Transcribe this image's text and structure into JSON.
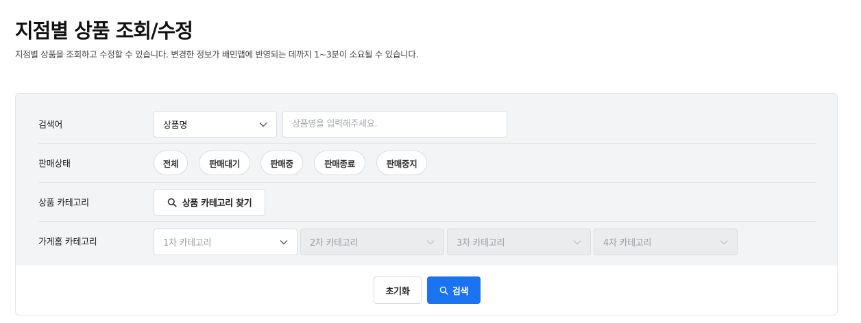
{
  "header": {
    "title": "지점별 상품 조회/수정",
    "description": "지점별 상품을 조회하고 수정할 수 있습니다. 변경한 정보가 배민앱에 반영되는 데까지 1~3분이 소요될 수 있습니다."
  },
  "filters": {
    "keyword": {
      "label": "검색어",
      "type_select_value": "상품명",
      "input_placeholder": "상품명을 입력해주세요.",
      "input_value": ""
    },
    "sale_status": {
      "label": "판매상태",
      "chips": [
        "전체",
        "판매대기",
        "판매중",
        "판매종료",
        "판매중지"
      ]
    },
    "product_category": {
      "label": "상품 카테고리",
      "button_label": "상품 카테고리 찾기"
    },
    "store_category": {
      "label": "가게홈 카테고리",
      "selects": [
        {
          "placeholder": "1차 카테고리",
          "disabled": false
        },
        {
          "placeholder": "2차 카테고리",
          "disabled": true
        },
        {
          "placeholder": "3차 카테고리",
          "disabled": true
        },
        {
          "placeholder": "4차 카테고리",
          "disabled": true
        }
      ]
    }
  },
  "actions": {
    "reset_label": "초기화",
    "search_label": "검색"
  },
  "colors": {
    "primary": "#1a73f0",
    "panel_bg": "#f3f4f6",
    "disabled_bg": "#ebecee"
  }
}
